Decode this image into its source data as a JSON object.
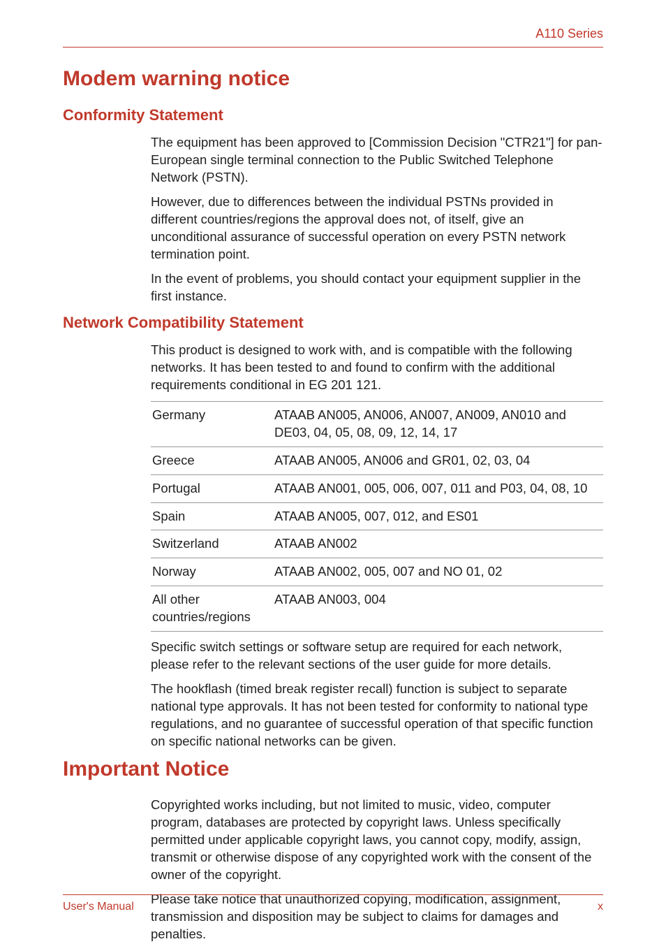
{
  "header": {
    "series": "A110 Series"
  },
  "section1": {
    "title": "Modem warning notice",
    "sub1": {
      "title": "Conformity Statement",
      "p1": "The equipment has been approved to [Commission Decision \"CTR21\"] for pan- European single terminal connection to the Public Switched Telephone Network (PSTN).",
      "p2": "However, due to differences between the individual PSTNs provided in different countries/regions the approval does not, of itself, give an unconditional assurance of successful operation on every PSTN network termination point.",
      "p3": "In the event of problems, you should contact your equipment supplier in the first instance."
    },
    "sub2": {
      "title": "Network Compatibility Statement",
      "p1": "This product is designed to work with, and is compatible with the following networks. It has been tested to and found to confirm with the additional requirements conditional in EG 201 121.",
      "table": [
        {
          "country": "Germany",
          "codes": "ATAAB AN005, AN006, AN007, AN009, AN010 and DE03, 04, 05, 08, 09, 12, 14, 17"
        },
        {
          "country": "Greece",
          "codes": "ATAAB AN005, AN006 and GR01, 02, 03, 04"
        },
        {
          "country": "Portugal",
          "codes": "ATAAB AN001, 005, 006, 007, 011 and P03, 04, 08, 10"
        },
        {
          "country": "Spain",
          "codes": "ATAAB AN005, 007, 012, and ES01"
        },
        {
          "country": "Switzerland",
          "codes": "ATAAB AN002"
        },
        {
          "country": "Norway",
          "codes": "ATAAB AN002, 005, 007 and NO 01, 02"
        },
        {
          "country": "All other countries/regions",
          "codes": "ATAAB AN003, 004"
        }
      ],
      "p2": "Specific switch settings or software setup are required for each network, please refer to the relevant sections of the user guide for more details.",
      "p3": "The hookflash (timed break register recall) function is subject to separate national type approvals. It has not been tested for conformity to national type regulations, and no guarantee of successful operation of that specific function on specific national networks can be given."
    }
  },
  "section2": {
    "title": "Important Notice",
    "p1": "Copyrighted works including, but not limited to music, video, computer program, databases are protected by copyright laws. Unless specifically permitted under applicable copyright laws, you cannot copy, modify, assign, transmit or otherwise dispose of any copyrighted work with the consent of the owner of the copyright.",
    "p2": "Please take notice that unauthorized copying, modification, assignment, transmission and disposition may be subject to claims for damages and penalties."
  },
  "footer": {
    "left": "User's Manual",
    "right": "x"
  }
}
